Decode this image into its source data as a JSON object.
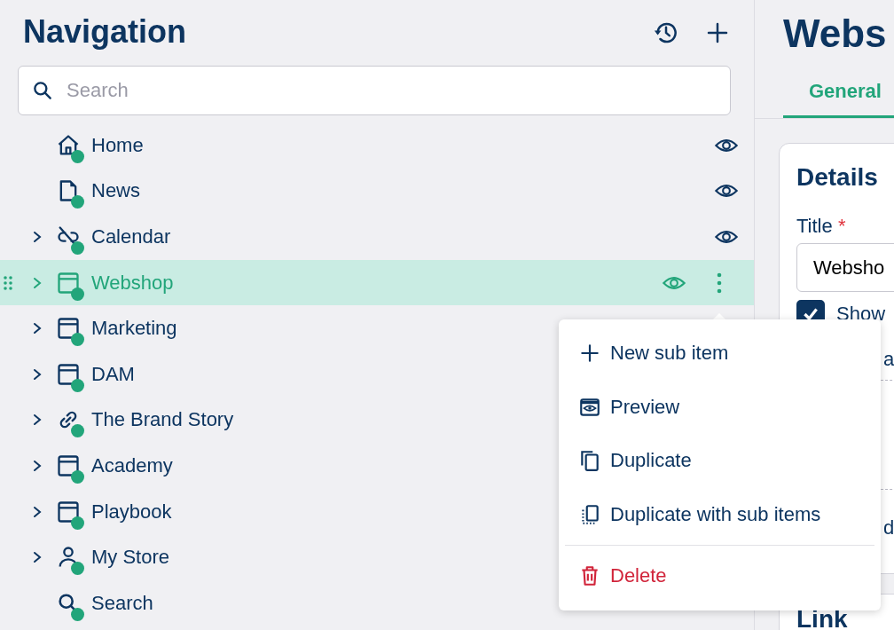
{
  "navigation": {
    "title": "Navigation",
    "search": {
      "placeholder": "Search"
    },
    "items": [
      {
        "label": "Home",
        "kind": "home",
        "has_children": false,
        "published": true,
        "visible": true,
        "selected": false
      },
      {
        "label": "News",
        "kind": "page",
        "has_children": false,
        "published": true,
        "visible": true,
        "selected": false
      },
      {
        "label": "Calendar",
        "kind": "unlink",
        "has_children": true,
        "published": true,
        "visible": true,
        "selected": false
      },
      {
        "label": "Webshop",
        "kind": "window",
        "has_children": true,
        "published": true,
        "visible": true,
        "selected": true
      },
      {
        "label": "Marketing",
        "kind": "window",
        "has_children": true,
        "published": true,
        "selected": false
      },
      {
        "label": "DAM",
        "kind": "window",
        "has_children": true,
        "published": true,
        "selected": false
      },
      {
        "label": "The Brand Story",
        "kind": "link",
        "has_children": true,
        "published": true,
        "selected": false
      },
      {
        "label": "Academy",
        "kind": "window",
        "has_children": true,
        "published": true,
        "selected": false
      },
      {
        "label": "Playbook",
        "kind": "window",
        "has_children": true,
        "published": true,
        "selected": false
      },
      {
        "label": "My Store",
        "kind": "person",
        "has_children": true,
        "published": true,
        "selected": false
      },
      {
        "label": "Search",
        "kind": "search",
        "has_children": false,
        "published": true,
        "selected": false
      }
    ]
  },
  "context_menu": {
    "items": [
      {
        "label": "New sub item",
        "kind": "plus",
        "danger": false
      },
      {
        "label": "Preview",
        "kind": "preview",
        "danger": false
      },
      {
        "label": "Duplicate",
        "kind": "copy",
        "danger": false
      },
      {
        "label": "Duplicate with sub items",
        "kind": "copy-tree",
        "danger": false
      },
      {
        "label": "Delete",
        "kind": "trash",
        "danger": true
      }
    ]
  },
  "editor": {
    "title": "Webs",
    "tabs": [
      {
        "label": "General",
        "selected": true
      }
    ],
    "details": {
      "heading": "Details",
      "title_label": "Title",
      "required_mark": "*",
      "title_value": "Websho",
      "show_checked": true,
      "show_label": "Show",
      "fragments": [
        "a",
        "d"
      ]
    },
    "link": {
      "heading": "Link"
    }
  }
}
